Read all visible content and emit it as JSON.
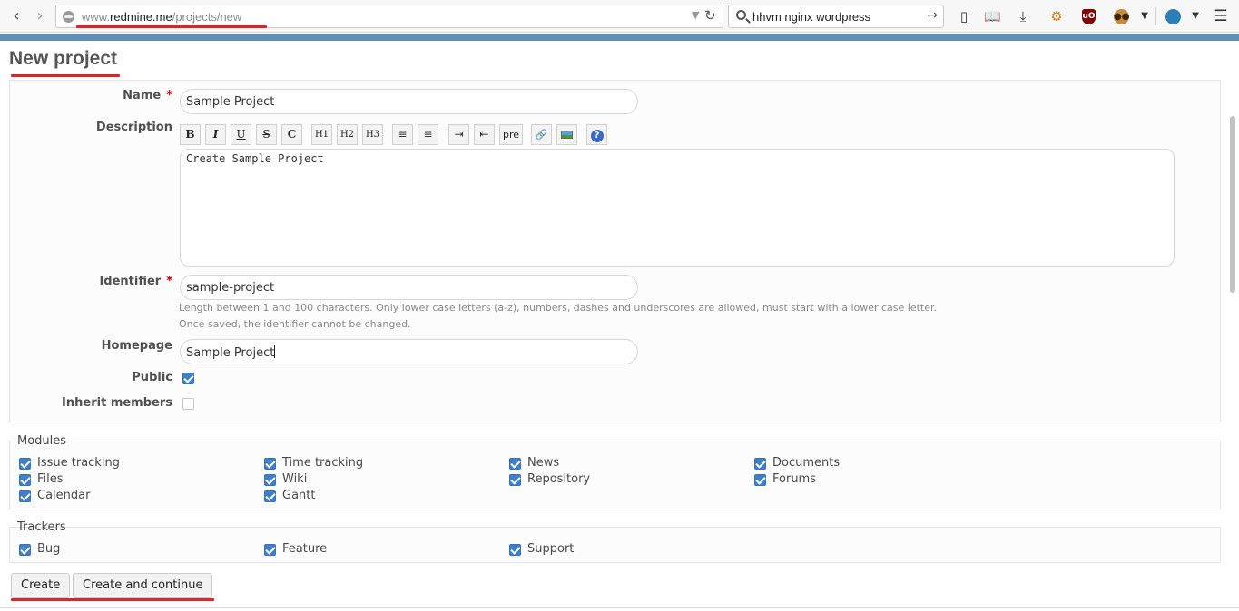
{
  "browser": {
    "url": {
      "prefix": "www.",
      "domain": "redmine.me",
      "path": "/projects/new"
    },
    "search_text": "hhvm nginx wordpress",
    "toolbar_icons": [
      "back-icon",
      "forward-icon",
      "reload-icon",
      "bookmark-icon",
      "reader-icon",
      "download-icon",
      "extension-icon",
      "ublock-icon",
      "tampermonkey-icon",
      "chevron-down-icon",
      "globe-extension-icon",
      "menu-icon"
    ]
  },
  "page": {
    "title": "New project",
    "accent_color": "#628db6",
    "highlight_color": "#d4262c"
  },
  "form": {
    "name": {
      "label": "Name",
      "required": "*",
      "value": "Sample Project"
    },
    "description": {
      "label": "Description",
      "value": "Create Sample Project",
      "toolbar": [
        "B",
        "I",
        "U",
        "S",
        "C",
        "H1",
        "H2",
        "H3",
        "ul",
        "ol",
        "indent-right",
        "indent-left",
        "pre",
        "link",
        "image",
        "help"
      ]
    },
    "identifier": {
      "label": "Identifier",
      "required": "*",
      "value": "sample-project",
      "hint1": "Length between 1 and 100 characters. Only lower case letters (a-z), numbers, dashes and underscores are allowed, must start with a lower case letter.",
      "hint2": "Once saved, the identifier cannot be changed."
    },
    "homepage": {
      "label": "Homepage",
      "value": "Sample Project"
    },
    "public": {
      "label": "Public",
      "checked": true
    },
    "inherit_members": {
      "label": "Inherit members",
      "checked": false
    }
  },
  "modules": {
    "legend": "Modules",
    "items": [
      {
        "label": "Issue tracking",
        "checked": true
      },
      {
        "label": "Time tracking",
        "checked": true
      },
      {
        "label": "News",
        "checked": true
      },
      {
        "label": "Documents",
        "checked": true
      },
      {
        "label": "Files",
        "checked": true
      },
      {
        "label": "Wiki",
        "checked": true
      },
      {
        "label": "Repository",
        "checked": true
      },
      {
        "label": "Forums",
        "checked": true
      },
      {
        "label": "Calendar",
        "checked": true
      },
      {
        "label": "Gantt",
        "checked": true
      }
    ]
  },
  "trackers": {
    "legend": "Trackers",
    "items": [
      {
        "label": "Bug",
        "checked": true
      },
      {
        "label": "Feature",
        "checked": true
      },
      {
        "label": "Support",
        "checked": true
      }
    ]
  },
  "buttons": {
    "create": "Create",
    "create_continue": "Create and continue"
  }
}
